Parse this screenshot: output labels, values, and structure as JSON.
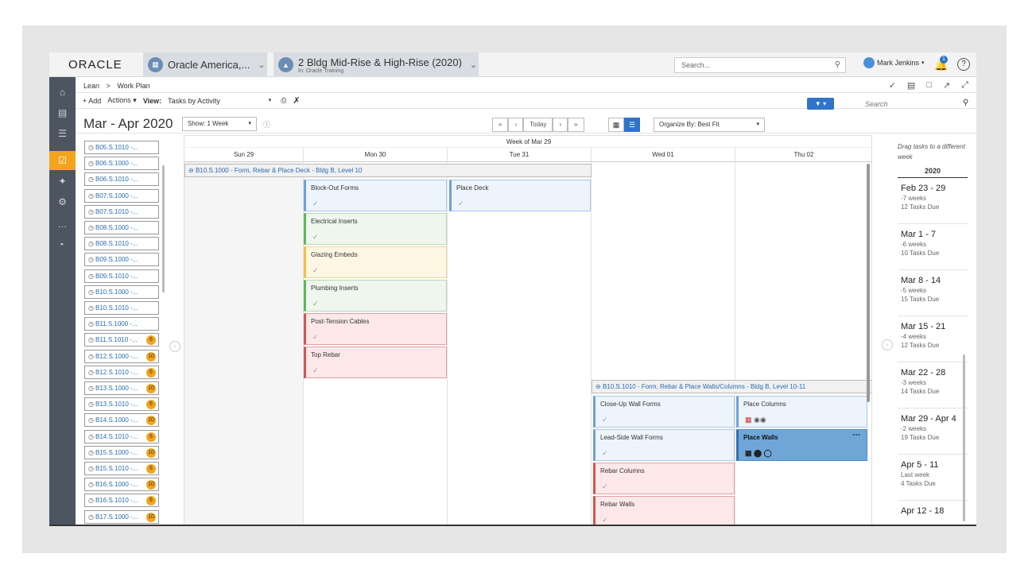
{
  "app": {
    "logo": "ORACLE",
    "company": "Oracle America,...",
    "project": "2 Bldg Mid-Rise & High-Rise (2020)",
    "project_sub": "In: Oracle Training",
    "search_placeholder": "Search...",
    "user": "Mark Jenkins",
    "notifications": "1"
  },
  "breadcrumb": {
    "root": "Lean",
    "sep": ">",
    "page": "Work Plan"
  },
  "toolbar": {
    "add": "+ Add",
    "actions": "Actions",
    "view_label": "View:",
    "view_value": "Tasks by Activity",
    "search_placeholder": "Search"
  },
  "controls": {
    "period": "Mar - Apr 2020",
    "show": "Show: 1 Week",
    "today": "Today",
    "organize": "Organize By: Best Fit"
  },
  "tasklist": [
    {
      "label": "B05.S.1010 -...",
      "count": ""
    },
    {
      "label": "B06.S.1000 -...",
      "count": ""
    },
    {
      "label": "B06.S.1010 -...",
      "count": ""
    },
    {
      "label": "B07.S.1000 -...",
      "count": ""
    },
    {
      "label": "B07.S.1010 -...",
      "count": ""
    },
    {
      "label": "B08.S.1000 -...",
      "count": ""
    },
    {
      "label": "B08.S.1010 -...",
      "count": ""
    },
    {
      "label": "B09.S.1000 -...",
      "count": ""
    },
    {
      "label": "B09.S.1010 -...",
      "count": ""
    },
    {
      "label": "B10.S.1000 -...",
      "count": ""
    },
    {
      "label": "B10.S.1010 -...",
      "count": ""
    },
    {
      "label": "B11.S.1000 -...",
      "count": ""
    },
    {
      "label": "B11.S.1010 -...",
      "count": "6"
    },
    {
      "label": "B12.S.1000 -...",
      "count": "10"
    },
    {
      "label": "B12.S.1010 -...",
      "count": "6"
    },
    {
      "label": "B13.S.1000 -...",
      "count": "10"
    },
    {
      "label": "B13.S.1010 -...",
      "count": "6"
    },
    {
      "label": "B14.S.1000 -...",
      "count": "10"
    },
    {
      "label": "B14.S.1010 -...",
      "count": "6"
    },
    {
      "label": "B15.S.1000 -...",
      "count": "10"
    },
    {
      "label": "B15.S.1010 -...",
      "count": "6"
    },
    {
      "label": "B16.S.1000 -...",
      "count": "10"
    },
    {
      "label": "B16.S.1010 -...",
      "count": "6"
    },
    {
      "label": "B17.S.1000 -...",
      "count": "10"
    }
  ],
  "calendar": {
    "week_title": "Week of Mar 29",
    "days": [
      "Sun 29",
      "Mon 30",
      "Tue 31",
      "Wed 01",
      "Thu 02"
    ],
    "group1": "B10.S.1000 - Form, Rebar & Place Deck - Bldg B, Level 10",
    "group2": "B10.S.1010 - Form, Rebar & Place Walls/Columns - Bldg B, Level 10-11",
    "cards": {
      "c1": "Block-Out Forms",
      "c2": "Place Deck",
      "c3": "Electrical Inserts",
      "c4": "Glazing Embeds",
      "c5": "Plumbing Inserts",
      "c6": "Post-Tension Cables",
      "c7": "Top Rebar",
      "c8": "Close-Up Wall Forms",
      "c9": "Place Columns",
      "c10": "Lead-Side Wall Forms",
      "c11": "Place Walls",
      "c12": "Rebar Columns",
      "c13": "Rebar Walls"
    }
  },
  "weeks": {
    "hint": "Drag tasks to a different week",
    "year": "2020",
    "items": [
      {
        "range": "Feb 23 - 29",
        "rel": "-7 weeks",
        "due": "12 Tasks Due"
      },
      {
        "range": "Mar 1 - 7",
        "rel": "-6 weeks",
        "due": "10 Tasks Due"
      },
      {
        "range": "Mar 8 - 14",
        "rel": "-5 weeks",
        "due": "15 Tasks Due"
      },
      {
        "range": "Mar 15 - 21",
        "rel": "-4 weeks",
        "due": "12 Tasks Due"
      },
      {
        "range": "Mar 22 - 28",
        "rel": "-3 weeks",
        "due": "14 Tasks Due"
      },
      {
        "range": "Mar 29 - Apr 4",
        "rel": "-2 weeks",
        "due": "19 Tasks Due"
      },
      {
        "range": "Apr 5 - 11",
        "rel": "Last week",
        "due": "4 Tasks Due"
      },
      {
        "range": "Apr 12 - 18",
        "rel": "",
        "due": ""
      }
    ]
  },
  "colors": {
    "accent": "#f4a41c",
    "primary": "#2f74c8",
    "nav": "#4d5561"
  }
}
